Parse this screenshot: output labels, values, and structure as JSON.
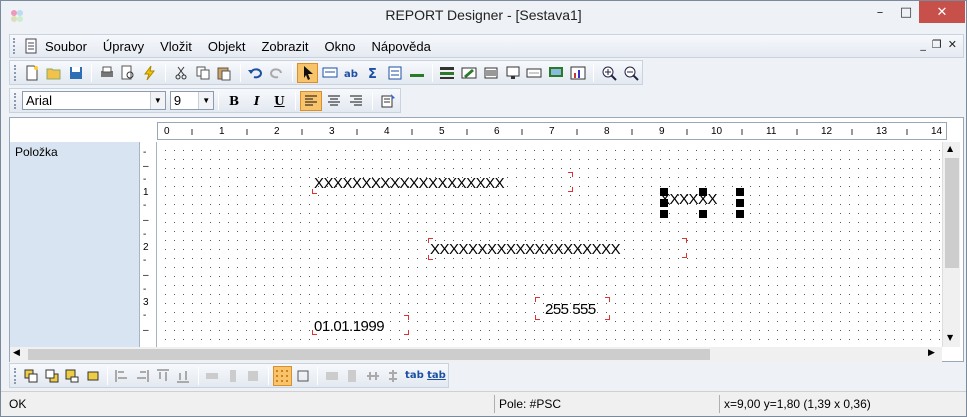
{
  "window": {
    "title": "REPORT Designer - [Sestava1]",
    "minimize": "–",
    "maximize": "□",
    "close": "✕"
  },
  "menu": {
    "items": [
      "Soubor",
      "Úpravy",
      "Vložit",
      "Objekt",
      "Zobrazit",
      "Okno",
      "Nápověda"
    ],
    "mdi_min": "_",
    "mdi_restore": "❐",
    "mdi_close": "✕"
  },
  "format": {
    "font": "Arial",
    "size": "9",
    "bold": "B",
    "italic": "I",
    "underline": "U"
  },
  "ruler": {
    "ticks": [
      "0",
      "1",
      "2",
      "3",
      "4",
      "5",
      "6",
      "7",
      "8",
      "9",
      "10",
      "11",
      "12",
      "13",
      "14"
    ]
  },
  "vruler": {
    "ticks": [
      "1",
      "2",
      "3"
    ]
  },
  "section": {
    "label": "Položka"
  },
  "fields": {
    "f1": "XXXXXXXXXXXXXXXXXXXX",
    "f2": "XXXXXX",
    "f3": "XXXXXXXXXXXXXXXXXXXX",
    "f4": "255 555",
    "f5": "01.01.1999"
  },
  "toolbar2": {
    "tab1": "tab",
    "tab2": "tab"
  },
  "status": {
    "message": "OK",
    "field": "Pole: #PSC",
    "coords": "x=9,00  y=1,80  (1,39 x 0,36)"
  },
  "colors": {
    "accent": "#f7c46b",
    "guide": "#d33333",
    "close": "#c7514a",
    "panel": "#d9e4f3"
  }
}
